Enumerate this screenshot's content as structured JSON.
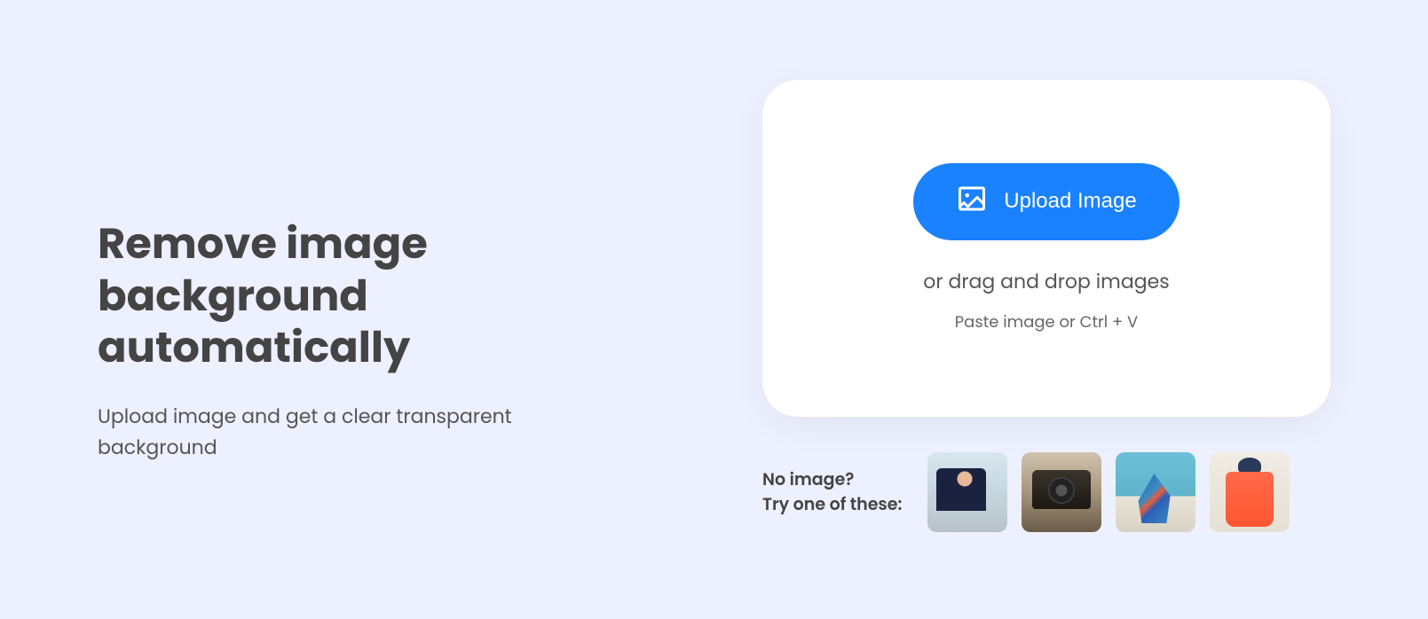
{
  "hero": {
    "headline": "Remove image background automatically",
    "subheadline": "Upload image and get a clear transparent background"
  },
  "upload": {
    "button_label": "Upload Image",
    "drag_text": "or drag and drop images",
    "paste_text": "Paste image or Ctrl + V"
  },
  "samples": {
    "no_image_label": "No image?",
    "try_label": "Try one of these:",
    "items": [
      {
        "name": "person-stretching"
      },
      {
        "name": "vintage-camera"
      },
      {
        "name": "blue-high-heel"
      },
      {
        "name": "woman-coral-jacket"
      }
    ]
  }
}
